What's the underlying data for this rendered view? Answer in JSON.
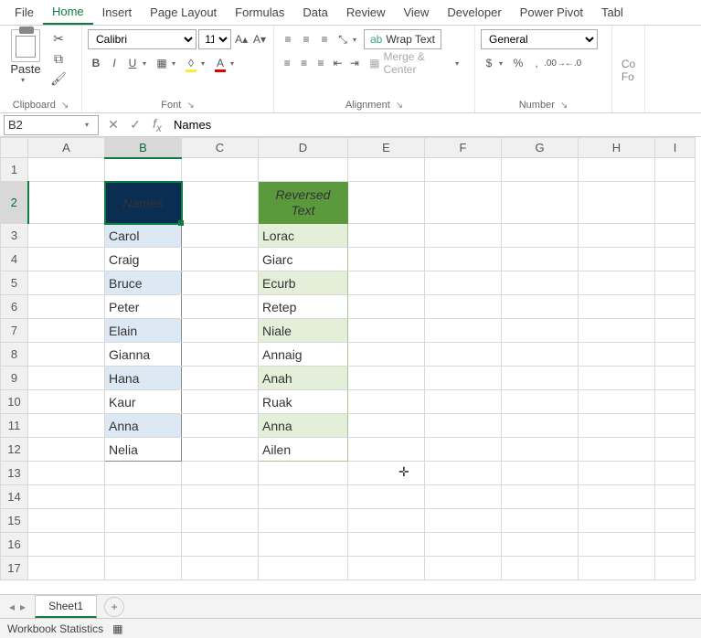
{
  "ribbon": {
    "tabs": [
      "File",
      "Home",
      "Insert",
      "Page Layout",
      "Formulas",
      "Data",
      "Review",
      "View",
      "Developer",
      "Power Pivot",
      "Tabl"
    ],
    "active_tab": "Home",
    "clipboard": {
      "paste": "Paste",
      "label": "Clipboard"
    },
    "font": {
      "name": "Calibri",
      "size": "11",
      "bold": "B",
      "italic": "I",
      "underline": "U",
      "label": "Font"
    },
    "alignment": {
      "wrap": "Wrap Text",
      "merge": "Merge & Center",
      "label": "Alignment"
    },
    "number": {
      "format": "General",
      "label": "Number"
    },
    "extra": {
      "cond1": "Co",
      "cond2": "Fo"
    }
  },
  "formula": {
    "cell_ref": "B2",
    "value": "Names"
  },
  "columns": [
    "A",
    "B",
    "C",
    "D",
    "E",
    "F",
    "G",
    "H",
    "I"
  ],
  "rows": [
    "1",
    "2",
    "3",
    "4",
    "5",
    "6",
    "7",
    "8",
    "9",
    "10",
    "11",
    "12",
    "13",
    "14",
    "15",
    "16",
    "17"
  ],
  "headers": {
    "names": "Names",
    "reversed": "Reversed Text"
  },
  "data": {
    "names": [
      "Carol",
      "Craig",
      "Bruce",
      "Peter",
      "Elain",
      "Gianna",
      "Hana",
      "Kaur",
      "Anna",
      "Nelia"
    ],
    "reversed": [
      "Lorac",
      "Giarc",
      "Ecurb",
      "Retep",
      "Niale",
      "Annaig",
      "Anah",
      "Ruak",
      "Anna",
      "Ailen"
    ]
  },
  "sheet_tabs": {
    "active": "Sheet1"
  },
  "status": {
    "stats": "Workbook Statistics"
  },
  "chart_data": {
    "type": "table",
    "columns": [
      "Names",
      "Reversed Text"
    ],
    "rows": [
      [
        "Carol",
        "Lorac"
      ],
      [
        "Craig",
        "Giarc"
      ],
      [
        "Bruce",
        "Ecurb"
      ],
      [
        "Peter",
        "Retep"
      ],
      [
        "Elain",
        "Niale"
      ],
      [
        "Gianna",
        "Annaig"
      ],
      [
        "Hana",
        "Anah"
      ],
      [
        "Kaur",
        "Ruak"
      ],
      [
        "Anna",
        "Anna"
      ],
      [
        "Nelia",
        "Ailen"
      ]
    ]
  }
}
